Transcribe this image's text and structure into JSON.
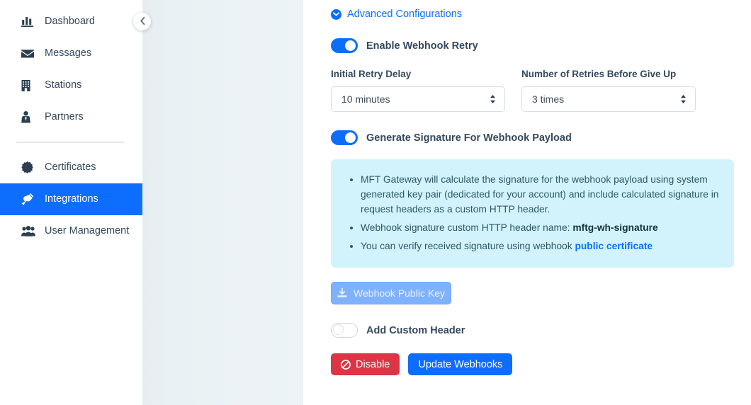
{
  "sidebar": {
    "items": [
      {
        "label": "Dashboard",
        "icon": "chart-bar-icon",
        "active": false
      },
      {
        "label": "Messages",
        "icon": "envelope-icon",
        "active": false
      },
      {
        "label": "Stations",
        "icon": "building-icon",
        "active": false
      },
      {
        "label": "Partners",
        "icon": "user-tie-icon",
        "active": false
      },
      {
        "label": "Certificates",
        "icon": "certificate-icon",
        "active": false
      },
      {
        "label": "Integrations",
        "icon": "plug-icon",
        "active": true
      },
      {
        "label": "User Management",
        "icon": "users-icon",
        "active": false
      }
    ],
    "collapse_icon": "chevron-left-icon",
    "active_color": "#0d6efd"
  },
  "main": {
    "advanced_configurations": {
      "label": "Advanced Configurations",
      "icon": "chevron-down-circle-icon",
      "color": "#0d6efd"
    },
    "enable_webhook_retry": {
      "label": "Enable Webhook Retry",
      "state": "on"
    },
    "initial_retry_delay": {
      "label": "Initial Retry Delay",
      "value": "10 minutes"
    },
    "retries_before_give_up": {
      "label": "Number of Retries Before Give Up",
      "value": "3 times"
    },
    "generate_signature": {
      "label": "Generate Signature For Webhook Payload",
      "state": "on"
    },
    "info_box": {
      "background": "#d2f3fc",
      "bullets": [
        {
          "text_before": "MFT Gateway will calculate the signature for the webhook payload using system generated key pair (dedicated for your account) and include calculated signature in request headers as a custom HTTP header.",
          "bold": "",
          "text_after": "",
          "link": ""
        },
        {
          "text_before": "Webhook signature custom HTTP header name: ",
          "bold": "mftg-wh-signature",
          "text_after": "",
          "link": ""
        },
        {
          "text_before": "You can verify received signature using webhook ",
          "bold": "",
          "text_after": "",
          "link": "public certificate"
        }
      ]
    },
    "webhook_public_key_button": {
      "label": "Webhook Public Key",
      "icon": "download-icon",
      "disabled": true
    },
    "add_custom_header": {
      "label": "Add Custom Header",
      "state": "off"
    },
    "disable_button": {
      "label": "Disable",
      "icon": "ban-icon",
      "color": "#dc3545"
    },
    "update_webhooks_button": {
      "label": "Update Webhooks",
      "color": "#0d6efd"
    }
  }
}
